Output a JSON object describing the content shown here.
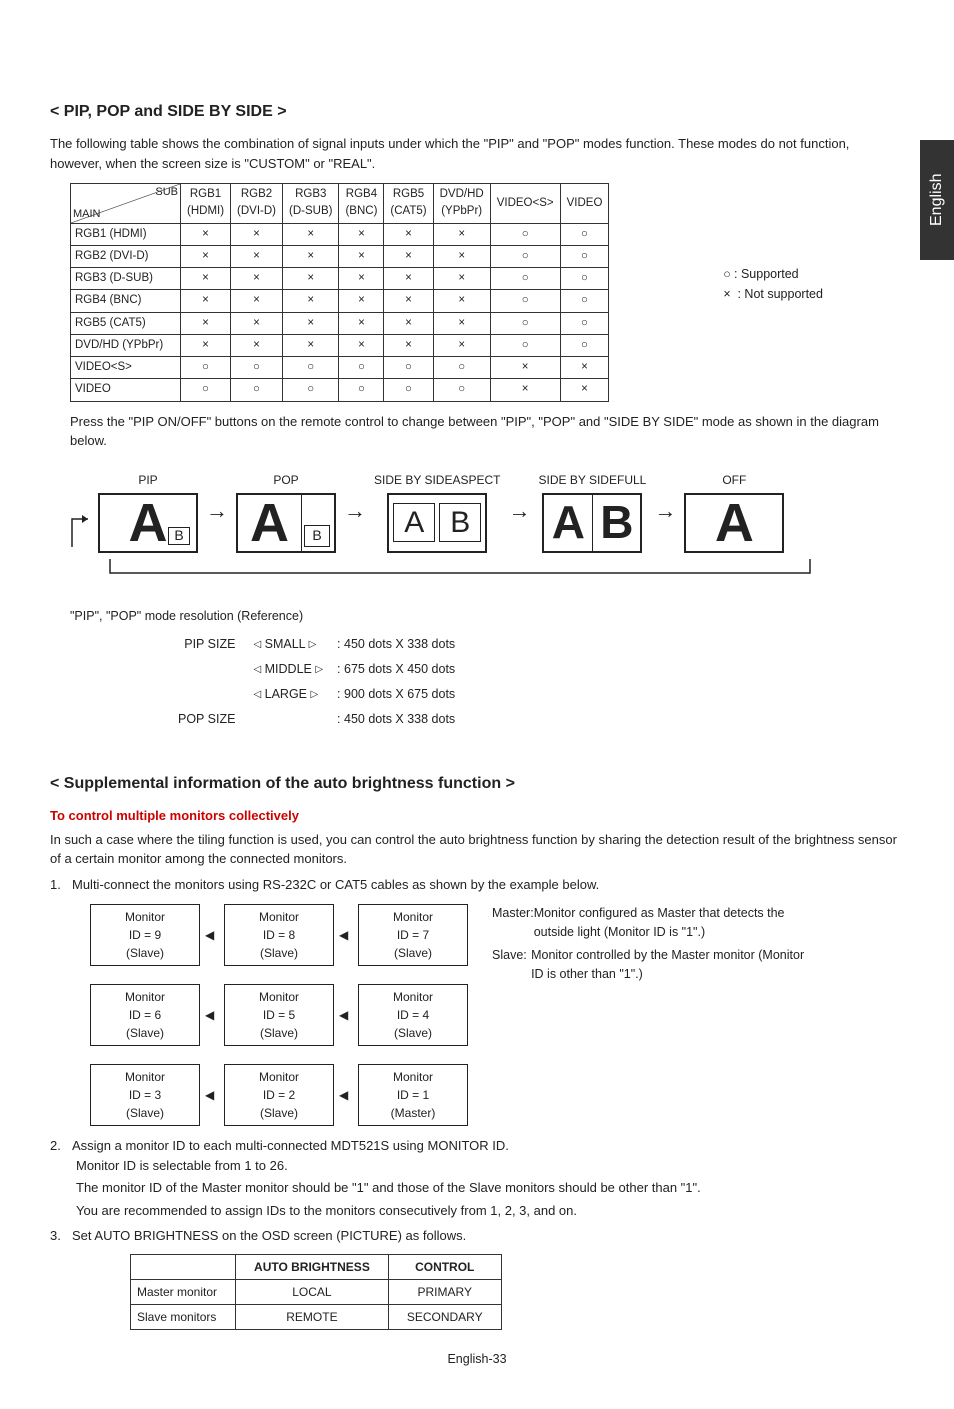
{
  "lang_tab": "English",
  "section1": {
    "heading": "< PIP, POP and SIDE BY SIDE >",
    "intro": "The following table shows the combination of signal inputs under which the \"PIP\" and \"POP\" modes function. These modes do not function, however, when the screen size is \"CUSTOM\" or \"REAL\".",
    "corner_sub": "SUB",
    "corner_main": "MAIN",
    "col_headers": [
      {
        "l1": "RGB1",
        "l2": "(HDMI)"
      },
      {
        "l1": "RGB2",
        "l2": "(DVI-D)"
      },
      {
        "l1": "RGB3",
        "l2": "(D-SUB)"
      },
      {
        "l1": "RGB4",
        "l2": "(BNC)"
      },
      {
        "l1": "RGB5",
        "l2": "(CAT5)"
      },
      {
        "l1": "DVD/HD",
        "l2": "(YPbPr)"
      },
      {
        "l1": "VIDEO<S>",
        "l2": ""
      },
      {
        "l1": "VIDEO",
        "l2": ""
      }
    ],
    "rows": [
      {
        "name": "RGB1 (HDMI)",
        "cells": [
          "×",
          "×",
          "×",
          "×",
          "×",
          "×",
          "○",
          "○"
        ]
      },
      {
        "name": "RGB2 (DVI-D)",
        "cells": [
          "×",
          "×",
          "×",
          "×",
          "×",
          "×",
          "○",
          "○"
        ]
      },
      {
        "name": "RGB3 (D-SUB)",
        "cells": [
          "×",
          "×",
          "×",
          "×",
          "×",
          "×",
          "○",
          "○"
        ]
      },
      {
        "name": "RGB4 (BNC)",
        "cells": [
          "×",
          "×",
          "×",
          "×",
          "×",
          "×",
          "○",
          "○"
        ]
      },
      {
        "name": "RGB5 (CAT5)",
        "cells": [
          "×",
          "×",
          "×",
          "×",
          "×",
          "×",
          "○",
          "○"
        ]
      },
      {
        "name": "DVD/HD (YPbPr)",
        "cells": [
          "×",
          "×",
          "×",
          "×",
          "×",
          "×",
          "○",
          "○"
        ]
      },
      {
        "name": "VIDEO<S>",
        "cells": [
          "○",
          "○",
          "○",
          "○",
          "○",
          "○",
          "×",
          "×"
        ]
      },
      {
        "name": "VIDEO",
        "cells": [
          "○",
          "○",
          "○",
          "○",
          "○",
          "○",
          "×",
          "×"
        ]
      }
    ],
    "legend_supported": "Supported",
    "legend_not_supported": "Not supported",
    "after_table": "Press the \"PIP ON/OFF\" buttons on the remote control to change between \"PIP\", \"POP\" and \"SIDE BY SIDE\" mode as shown in the diagram below.",
    "modes": {
      "pip": "PIP",
      "pop": "POP",
      "sbs_aspect_l1": "SIDE BY SIDE",
      "sbs_aspect_l2": "ASPECT",
      "sbs_full_l1": "SIDE BY SIDE",
      "sbs_full_l2": "FULL",
      "off": "OFF"
    },
    "res_ref_title": "\"PIP\", \"POP\" mode resolution (Reference)",
    "pip_size_label": "PIP SIZE",
    "pop_size_label": "POP SIZE",
    "size_small": "SMALL",
    "size_middle": "MIDDLE",
    "size_large": "LARGE",
    "res_small": ": 450 dots X 338 dots",
    "res_middle": ": 675 dots X 450 dots",
    "res_large": ": 900 dots X 675 dots",
    "res_pop": ": 450 dots X 338 dots"
  },
  "section2": {
    "heading": "< Supplemental information of the auto brightness function >",
    "subhead": "To control multiple monitors collectively",
    "body": "In such a case where the tiling function is used, you can control the auto brightness function by sharing the detection result of the brightness sensor of a certain monitor among the connected monitors.",
    "step1": "Multi-connect the monitors using RS-232C or CAT5 cables as shown by the example below.",
    "step2": "Assign a monitor ID to each multi-connected MDT521S using MONITOR ID.",
    "step2a": "Monitor ID is selectable from 1 to 26.",
    "step2b": "The monitor ID of the Master monitor should be \"1\" and those of the Slave monitors should be other than \"1\".",
    "step2c": "You are recommended to assign IDs to the monitors consecutively from 1, 2, 3, and on.",
    "step3": "Set AUTO BRIGHTNESS on the OSD screen (PICTURE) as follows.",
    "monitors": [
      {
        "t": "Monitor",
        "id": "ID = 9",
        "r": "(Slave)"
      },
      {
        "t": "Monitor",
        "id": "ID = 8",
        "r": "(Slave)"
      },
      {
        "t": "Monitor",
        "id": "ID = 7",
        "r": "(Slave)"
      },
      {
        "t": "Monitor",
        "id": "ID = 6",
        "r": "(Slave)"
      },
      {
        "t": "Monitor",
        "id": "ID = 5",
        "r": "(Slave)"
      },
      {
        "t": "Monitor",
        "id": "ID = 4",
        "r": "(Slave)"
      },
      {
        "t": "Monitor",
        "id": "ID = 3",
        "r": "(Slave)"
      },
      {
        "t": "Monitor",
        "id": "ID = 2",
        "r": "(Slave)"
      },
      {
        "t": "Monitor",
        "id": "ID = 1",
        "r": "(Master)"
      }
    ],
    "master_label": "Master:",
    "master_desc": "Monitor configured as Master that detects the outside light (Monitor ID is \"1\".)",
    "slave_label": "Slave:",
    "slave_desc": "Monitor controlled by the Master monitor (Monitor ID is other than \"1\".)",
    "ab_table": {
      "h1": "AUTO BRIGHTNESS",
      "h2": "CONTROL",
      "r1": {
        "name": "Master monitor",
        "c1": "LOCAL",
        "c2": "PRIMARY"
      },
      "r2": {
        "name": "Slave monitors",
        "c1": "REMOTE",
        "c2": "SECONDARY"
      }
    }
  },
  "footer": "English-33"
}
